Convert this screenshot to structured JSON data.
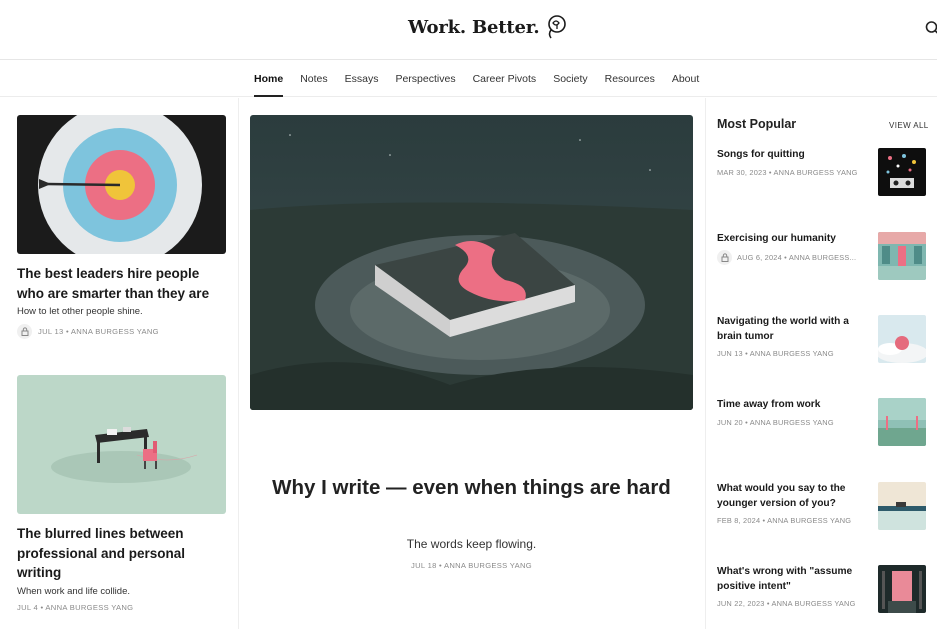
{
  "header": {
    "logo_text": "Work. Better."
  },
  "nav": {
    "items": [
      "Home",
      "Notes",
      "Essays",
      "Perspectives",
      "Career Pivots",
      "Society",
      "Resources",
      "About"
    ],
    "active": "Home"
  },
  "left_articles": [
    {
      "title": "The best leaders hire people who are smarter than they are",
      "subtitle": "How to let other people shine.",
      "meta": "JUL 13 • ANNA BURGESS YANG",
      "locked": true
    },
    {
      "title": "The blurred lines between professional and personal writing",
      "subtitle": "When work and life collide.",
      "meta": "JUL 4 • ANNA BURGESS YANG",
      "locked": false
    }
  ],
  "featured": {
    "title": "Why I write — even when things are hard",
    "subtitle": "The words keep flowing.",
    "meta": "JUL 18 • ANNA BURGESS YANG"
  },
  "popular": {
    "heading": "Most Popular",
    "view_all": "VIEW ALL",
    "items": [
      {
        "title": "Songs for quitting",
        "meta": "MAR 30, 2023 • ANNA BURGESS YANG",
        "locked": false
      },
      {
        "title": "Exercising our humanity",
        "meta": "AUG 6, 2024 • ANNA BURGESS...",
        "locked": true
      },
      {
        "title": "Navigating the world with a brain tumor",
        "meta": "JUN 13 • ANNA BURGESS YANG",
        "locked": false
      },
      {
        "title": "Time away from work",
        "meta": "JUN 20 • ANNA BURGESS YANG",
        "locked": false
      },
      {
        "title": "What would you say to the younger version of you?",
        "meta": "FEB 8, 2024 • ANNA BURGESS YANG",
        "locked": false
      },
      {
        "title": "What's wrong with \"assume positive intent\"",
        "meta": "JUN 22, 2023 • ANNA BURGESS YANG",
        "locked": false
      }
    ]
  },
  "colors": {
    "accent_pink": "#ec6f84",
    "text_dark": "#1a1a1a",
    "meta_gray": "#8a8a8a"
  },
  "icons": {
    "search": "search-icon",
    "lock": "lock-icon",
    "logo": "logo-mark-icon"
  }
}
